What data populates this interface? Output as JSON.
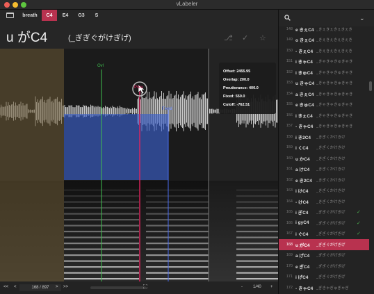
{
  "window": {
    "title": "vLabeler"
  },
  "tabs": [
    {
      "label": "breath",
      "active": false
    },
    {
      "label": "C4",
      "active": true
    },
    {
      "label": "E4",
      "active": false
    },
    {
      "label": "G3",
      "active": false
    },
    {
      "label": "S",
      "active": false
    }
  ],
  "entry": {
    "alias": "u がC4",
    "sample": "(_ぎぎぐがけぎげ)",
    "icons": [
      "fork-icon",
      "check-icon",
      "star-icon"
    ]
  },
  "markers": {
    "ovl_label": "Ovl",
    "fixed_label": "Fixed",
    "preu_label": "Preu"
  },
  "popup": {
    "offset": "Offset: 2455.95",
    "overlap": "Overlap: 200.0",
    "preutterance": "Preutterance: 400.0",
    "fixed": "Fixed: 550.0",
    "cutoff": "Cutoff: -762.51"
  },
  "bottom": {
    "first": "<<",
    "prev": "<",
    "counter": "168 / 897",
    "next": ">",
    "last": ">>",
    "zoom_out": "-",
    "zoom_level": "1/40",
    "zoom_in": "+"
  },
  "entries": [
    {
      "num": "148",
      "alias": "e きぇC4",
      "sample": "_きぇきぇきぇきぇき",
      "checked": false,
      "selected": false
    },
    {
      "num": "149",
      "alias": "o きぇC4",
      "sample": "_きぇきぇきぇきぇき",
      "checked": false,
      "selected": false
    },
    {
      "num": "150",
      "alias": "- きぇC4",
      "sample": "_きぇきぇきぇきぇき",
      "checked": false,
      "selected": false
    },
    {
      "num": "151",
      "alias": "i きゃC4",
      "sample": "_きゃきゃきゅきゃき",
      "checked": false,
      "selected": false
    },
    {
      "num": "152",
      "alias": "i きゅC4",
      "sample": "_きゃきゃきゅきゃき",
      "checked": false,
      "selected": false
    },
    {
      "num": "153",
      "alias": "u きゃC4",
      "sample": "_きゃきゃきゅきゃき",
      "checked": false,
      "selected": false
    },
    {
      "num": "154",
      "alias": "a きぇC4",
      "sample": "_きゃきゃきゅきゃき",
      "checked": false,
      "selected": false
    },
    {
      "num": "155",
      "alias": "e きゅC4",
      "sample": "_きゃきゃきゅきゃき",
      "checked": false,
      "selected": false
    },
    {
      "num": "156",
      "alias": "i きぇC4",
      "sample": "_きゃきゃきゅきゃき",
      "checked": false,
      "selected": false
    },
    {
      "num": "157",
      "alias": "- きゃC4",
      "sample": "_きゃきゃきゅきゃき",
      "checked": false,
      "selected": false
    },
    {
      "num": "158",
      "alias": "i き2C4",
      "sample": "_きぎくかけきけ",
      "checked": false,
      "selected": false
    },
    {
      "num": "159",
      "alias": "i くC4",
      "sample": "_きぎくかけきけ",
      "checked": false,
      "selected": false
    },
    {
      "num": "160",
      "alias": "u かC4",
      "sample": "_きぎくかけきけ",
      "checked": false,
      "selected": false
    },
    {
      "num": "161",
      "alias": "a けC4",
      "sample": "_きぎくかけきけ",
      "checked": false,
      "selected": false
    },
    {
      "num": "162",
      "alias": "e き2C4",
      "sample": "_きぎくかけきけ",
      "checked": false,
      "selected": false
    },
    {
      "num": "163",
      "alias": "i けC4",
      "sample": "_きぎくかけきけ",
      "checked": false,
      "selected": false
    },
    {
      "num": "164",
      "alias": "- けC4",
      "sample": "_きぎくかけきけ",
      "checked": false,
      "selected": false
    },
    {
      "num": "165",
      "alias": "i ぎC4",
      "sample": "_ぎぎぐがげぎげ",
      "checked": true,
      "selected": false
    },
    {
      "num": "166",
      "alias": "i gyC4",
      "sample": "_ぎぎぐがげぎげ",
      "checked": true,
      "selected": false
    },
    {
      "num": "167",
      "alias": "i ぐC4",
      "sample": "_ぎぎぐがげぎげ",
      "checked": true,
      "selected": false
    },
    {
      "num": "168",
      "alias": "u がC4",
      "sample": "_ぎぎぐがげぎげ",
      "checked": false,
      "selected": true
    },
    {
      "num": "169",
      "alias": "a げC4",
      "sample": "_ぎぎぐがげぎげ",
      "checked": false,
      "selected": false
    },
    {
      "num": "170",
      "alias": "e ぎC4",
      "sample": "_ぎぎぐがげぎげ",
      "checked": false,
      "selected": false
    },
    {
      "num": "171",
      "alias": "i げC4",
      "sample": "_ぎぎぐがげぎげ",
      "checked": false,
      "selected": false
    },
    {
      "num": "172",
      "alias": "- きゃC4",
      "sample": "_ぎきゃぎゅぎゃぎ",
      "checked": false,
      "selected": false
    },
    {
      "num": "173",
      "alias": "i きゃC4",
      "sample": "_ぎきゃぎゅぎゃぎ",
      "checked": false,
      "selected": false
    }
  ],
  "colors": {
    "accent": "#b8324f",
    "offset_region": "#6b5a35",
    "overlap_region": "#3b5fc9",
    "ovl_line": "#3fbf4f",
    "preu_line": "#e0245e",
    "fixed_line": "#4a6cf0",
    "check": "#4caf50"
  }
}
